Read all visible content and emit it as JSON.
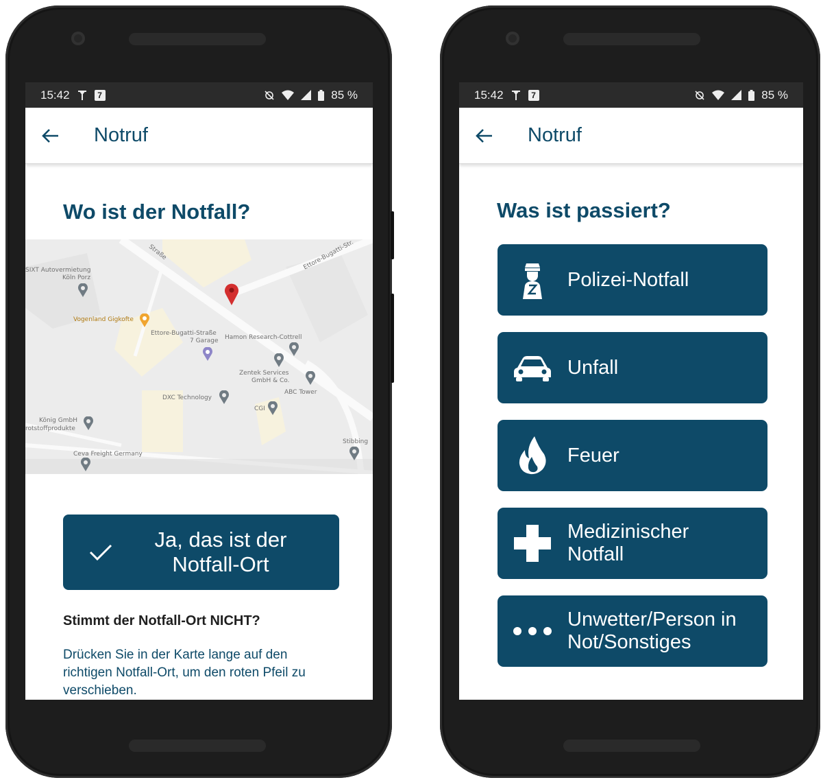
{
  "status": {
    "time": "15:42",
    "notification_badge": "7",
    "battery": "85 %"
  },
  "left_screen": {
    "appbar_title": "Notruf",
    "heading": "Wo ist der Notfall?",
    "map_labels": {
      "sixt": "SIXT Autovermietung",
      "sixt2": "Köln Porz",
      "vogelland": "Vogenland Gigkofte",
      "ettore_garage": "Ettore-Bugatti-Straße",
      "ettore_garage2": "7 Garage",
      "hamon": "Hamon Research-Cottrell",
      "zentek": "Zentek Services",
      "zentek2": "GmbH & Co.",
      "abc": "ABC Tower",
      "dxc": "DXC Technology",
      "cgi": "CGI",
      "koenig": "König GmbH",
      "koenig2": "rotstoffprodukte",
      "ceva": "Ceva Freight Germany",
      "stibbing": "Stibbing",
      "street1": "Ettore-Bugatti-Str.",
      "street2": "Straße"
    },
    "confirm_button": "Ja, das ist der Notfall-Ort",
    "question": "Stimmt der Notfall-Ort NICHT?",
    "hint": "Drücken Sie in der Karte lange auf den richtigen Notfall-Ort, um den roten Pfeil zu verschieben."
  },
  "right_screen": {
    "appbar_title": "Notruf",
    "heading": "Was ist passiert?",
    "categories": [
      {
        "label": "Polizei-Notfall",
        "icon": "police-officer-icon"
      },
      {
        "label": "Unfall",
        "icon": "car-crash-icon"
      },
      {
        "label": "Feuer",
        "icon": "fire-icon"
      },
      {
        "label": "Medizinischer Notfall",
        "icon": "medical-cross-icon"
      },
      {
        "label": "Unwetter/Person in Not/Sonstiges",
        "icon": "more-dots-icon"
      }
    ]
  },
  "colors": {
    "brand": "#0e4a68",
    "pin": "#d32f2f"
  }
}
